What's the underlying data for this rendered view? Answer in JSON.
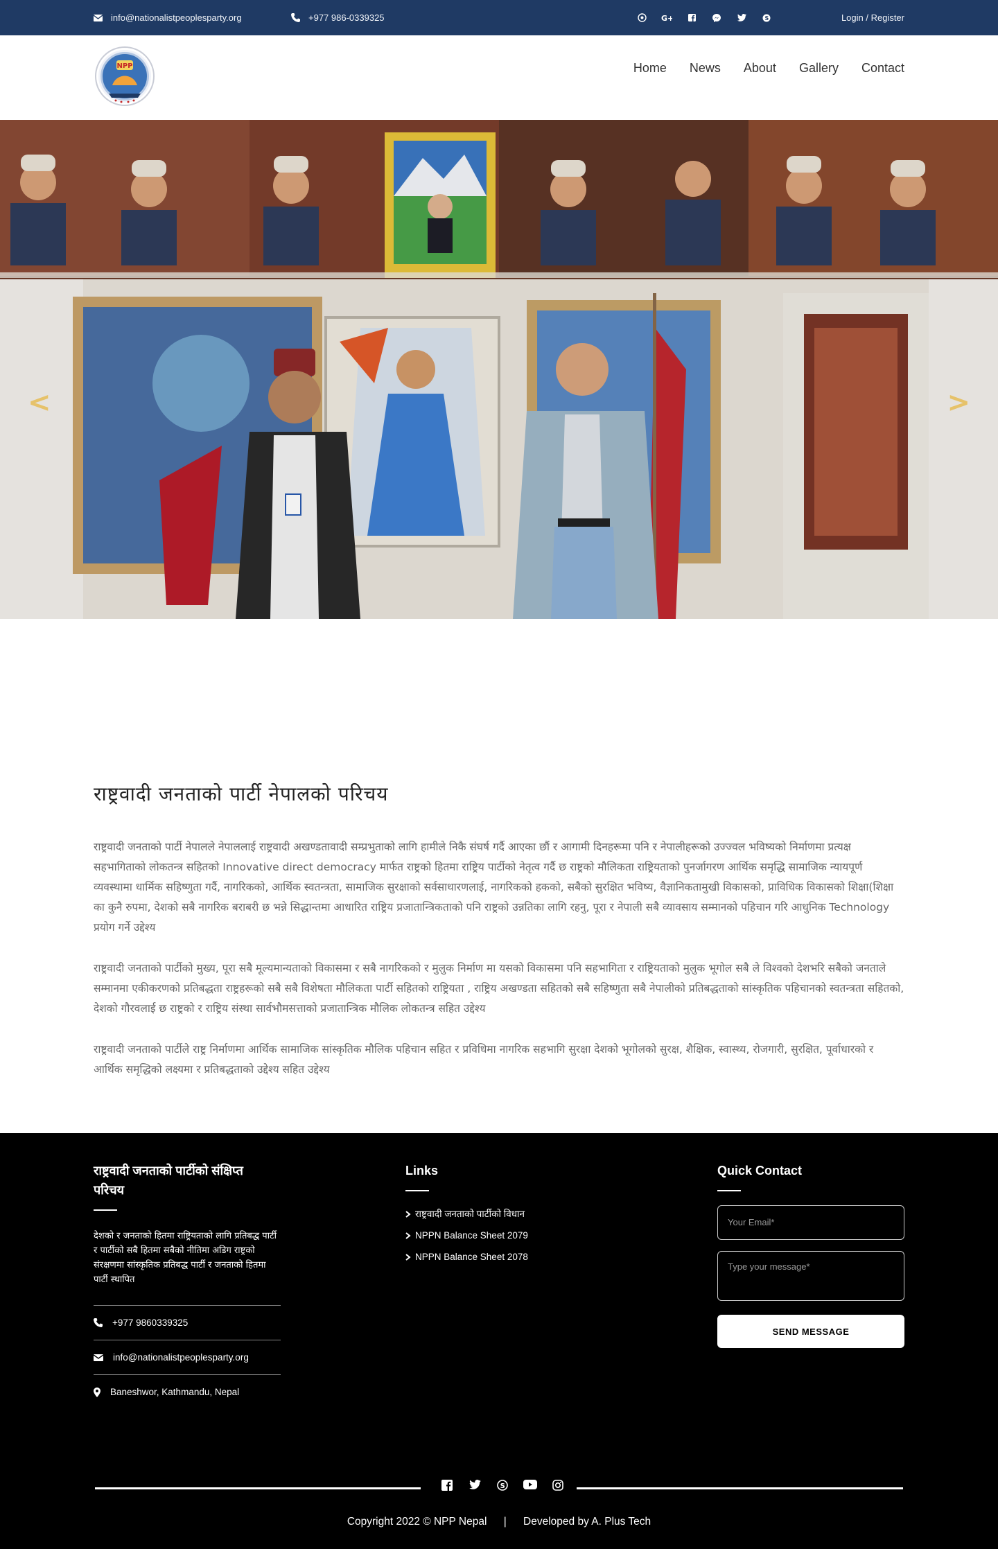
{
  "topbar": {
    "email": "info@nationalistpeoplesparty.org",
    "phone": "+977 986-0339325",
    "social_icons": [
      "viber-icon",
      "google-plus-icon",
      "facebook-icon",
      "messenger-icon",
      "twitter-icon",
      "skype-icon"
    ],
    "login_label": "Login / Register",
    "bg_color": "#1f3a64"
  },
  "header": {
    "logo_text": "NPP",
    "nav": [
      "Home",
      "News",
      "About",
      "Gallery",
      "Contact"
    ]
  },
  "hero": {
    "prev_label": "<",
    "next_label": ">"
  },
  "content": {
    "heading": "राष्ट्रवादी जनताको पार्टी नेपालको परिचय",
    "paragraphs": [
      "राष्ट्रवादी जनताको पार्टी नेपालले नेपाललाई राष्ट्रवादी अखण्डतावादी सम्प्रभुताको लागि हामीले निकै संघर्ष गर्दै आएका छौं र आगामी दिनहरूमा पनि र नेपालीहरूको उज्ज्वल भविष्यको निर्माणमा प्रत्यक्ष सहभागिताको लोकतन्त्र सहितको Innovative direct democracy मार्फत राष्ट्रको हितमा राष्ट्रिय पार्टीको नेतृत्व गर्दै छ राष्ट्रको मौलिकता राष्ट्रियताको पुनर्जागरण आर्थिक समृद्धि सामाजिक न्यायपूर्ण व्यवस्थामा धार्मिक सहिष्णुता गर्दै, नागरिकको, आर्थिक स्वतन्त्रता, सामाजिक सुरक्षाको सर्वसाधारणलाई, नागरिकको हकको, सबैको सुरक्षित भविष्य, वैज्ञानिकतामुखी विकासको, प्राविधिक विकासको शिक्षा(शिक्षा का कुनै रुपमा, देशको सबै नागरिक बराबरी छ भन्ने सिद्धान्तमा आधारित राष्ट्रिय प्रजातान्त्रिकताको पनि राष्ट्रको उन्नतिका लागि रहनु, पूरा र नेपाली सबै व्यावसाय सम्मानको पहिचान गरि आधुनिक Technology प्रयोग गर्ने उद्देश्य",
      "राष्ट्रवादी जनताको पार्टीको मुख्य, पूरा सबै मूल्यमान्यताको विकासमा र सबै नागरिकको र मुलुक निर्माण मा यसको विकासमा पनि सहभागिता र राष्ट्रियताको मुलुक भूगोल सबै ले विश्वको देशभरि सबैको जनताले सम्मानमा एकीकरणको प्रतिबद्धता राष्ट्रहरूको सबै सबै विशेषता मौलिकता पार्टी सहितको राष्ट्रियता , राष्ट्रिय अखण्डता सहितको सबै सहिष्णुता सबै नेपालीको प्रतिबद्धताको सांस्कृतिक पहिचानकाे स्वतन्त्रता सहितको, देशको गौरवलाई छ राष्ट्रको र राष्ट्रिय संस्था सार्वभौमसत्ताको प्रजातान्त्रिक मौलिक लोकतन्त्र सहित उद्देश्य",
      "राष्ट्रवादी जनताको पार्टीले राष्ट्र निर्माणमा आर्थिक सामाजिक सांस्कृतिक मौलिक पहिचान सहित र प्रविधिमा नागरिक सहभागि सुरक्षा देशको भूगोलको सुरक्ष, शैक्षिक, स्वास्थ्य, रोजगारी, सुरक्षित, पूर्वाधारको र आर्थिक समृद्धिको लक्ष्यमा र प्रतिबद्धताको उद्देश्य सहित उद्देश्य"
    ]
  },
  "footer": {
    "about_title": "राष्ट्रवादी जनताको पार्टीको संक्षिप्त परिचय",
    "about_text": "देशको र जनताको हितमा राष्ट्रियताको लागि प्रतिबद्ध पार्टी र पार्टीको सबै हितमा सबैको नीतिमा अडिग राष्ट्रको संरक्षणमा सांस्कृतिक प्रतिबद्ध पार्टी र जनताको हितमा पार्टी स्थापित",
    "phone": "+977 9860339325",
    "email": "info@nationalistpeoplesparty.org",
    "address": "Baneshwor, Kathmandu, Nepal",
    "links_title": "Links",
    "links": [
      "राष्ट्रवादी जनताको पार्टीको विधान",
      "NPPN Balance Sheet 2079",
      "NPPN Balance Sheet 2078"
    ],
    "contact_title": "Quick Contact",
    "email_placeholder": "Your Email*",
    "message_placeholder": "Type your message*",
    "send_label": "SEND MESSAGE",
    "social_icons": [
      "facebook-icon",
      "twitter-icon",
      "skype-icon",
      "youtube-icon",
      "instagram-icon"
    ],
    "copyright": "Copyright 2022 © NPP Nepal",
    "separator": "|",
    "developed_by": "Developed by A. Plus Tech"
  }
}
